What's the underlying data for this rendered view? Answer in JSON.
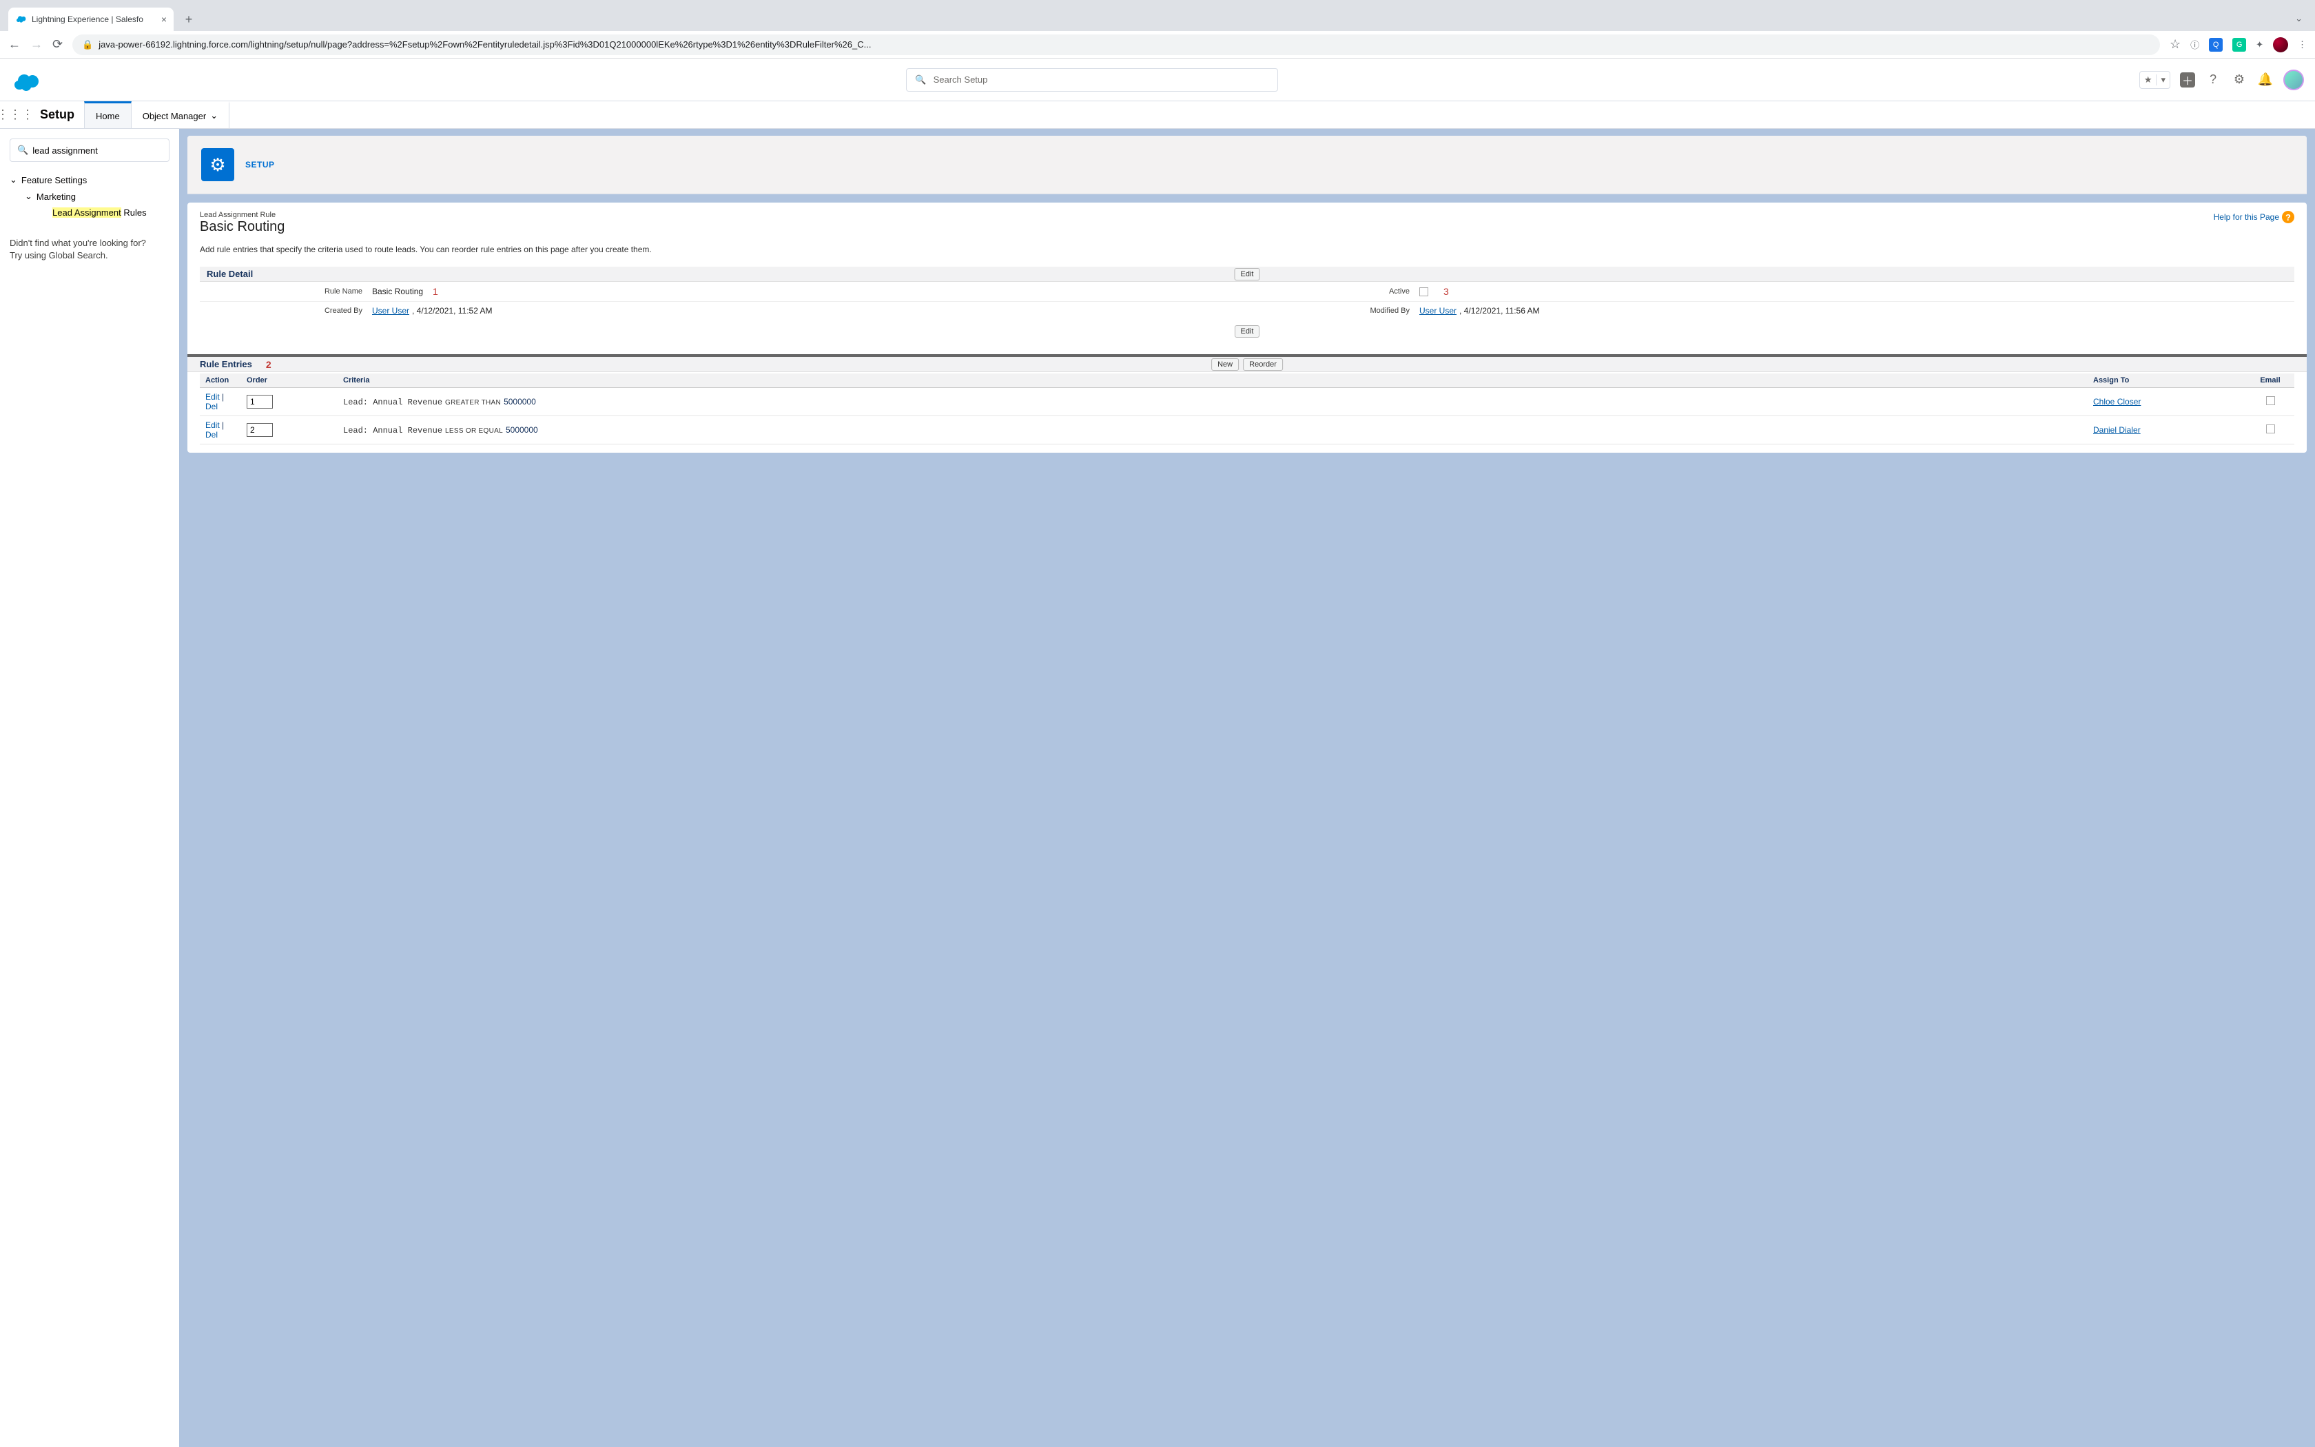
{
  "browser": {
    "tab_title": "Lightning Experience | Salesfo",
    "url": "java-power-66192.lightning.force.com/lightning/setup/null/page?address=%2Fsetup%2Fown%2Fentityruledetail.jsp%3Fid%3D01Q21000000lEKe%26rtype%3D1%26entity%3DRuleFilter%26_C..."
  },
  "sf_header": {
    "search_placeholder": "Search Setup"
  },
  "app_nav": {
    "app_name": "Setup",
    "tabs": {
      "home": "Home",
      "object_manager": "Object Manager"
    }
  },
  "sidebar": {
    "search_value": "lead assignment",
    "groups": {
      "feature_settings": "Feature Settings",
      "marketing": "Marketing",
      "lead_assignment_prefix": "Lead Assignment",
      "lead_assignment_suffix": " Rules"
    },
    "not_found_l1": "Didn't find what you're looking for?",
    "not_found_l2": "Try using Global Search."
  },
  "page": {
    "setup_label": "SETUP",
    "rule_sup": "Lead Assignment Rule",
    "rule_title": "Basic Routing",
    "help_link": "Help for this Page",
    "desc": "Add rule entries that specify the criteria used to route leads. You can reorder rule entries on this page after you create them.",
    "sections": {
      "detail": "Rule Detail",
      "entries": "Rule Entries"
    },
    "buttons": {
      "edit": "Edit",
      "new": "New",
      "reorder": "Reorder"
    },
    "fields": {
      "rule_name_lbl": "Rule Name",
      "rule_name_val": "Basic Routing",
      "active_lbl": "Active",
      "created_by_lbl": "Created By",
      "created_by_user": "User User",
      "created_by_time": ", 4/12/2021, 11:52 AM",
      "modified_by_lbl": "Modified By",
      "modified_by_user": "User User",
      "modified_by_time": ", 4/12/2021, 11:56 AM"
    },
    "annotations": {
      "one": "1",
      "two": "2",
      "three": "3"
    },
    "table": {
      "headers": {
        "action": "Action",
        "order": "Order",
        "criteria": "Criteria",
        "assign_to": "Assign To",
        "email": "Email"
      },
      "action_edit": "Edit",
      "action_sep": " | ",
      "action_del": "Del",
      "rows": [
        {
          "order": "1",
          "crit_field": "Lead: Annual Revenue",
          "crit_op": "GREATER THAN",
          "crit_val": "5000000",
          "assign_to": "Chloe Closer"
        },
        {
          "order": "2",
          "crit_field": "Lead: Annual Revenue",
          "crit_op": "LESS OR EQUAL",
          "crit_val": "5000000",
          "assign_to": "Daniel Dialer"
        }
      ]
    }
  }
}
